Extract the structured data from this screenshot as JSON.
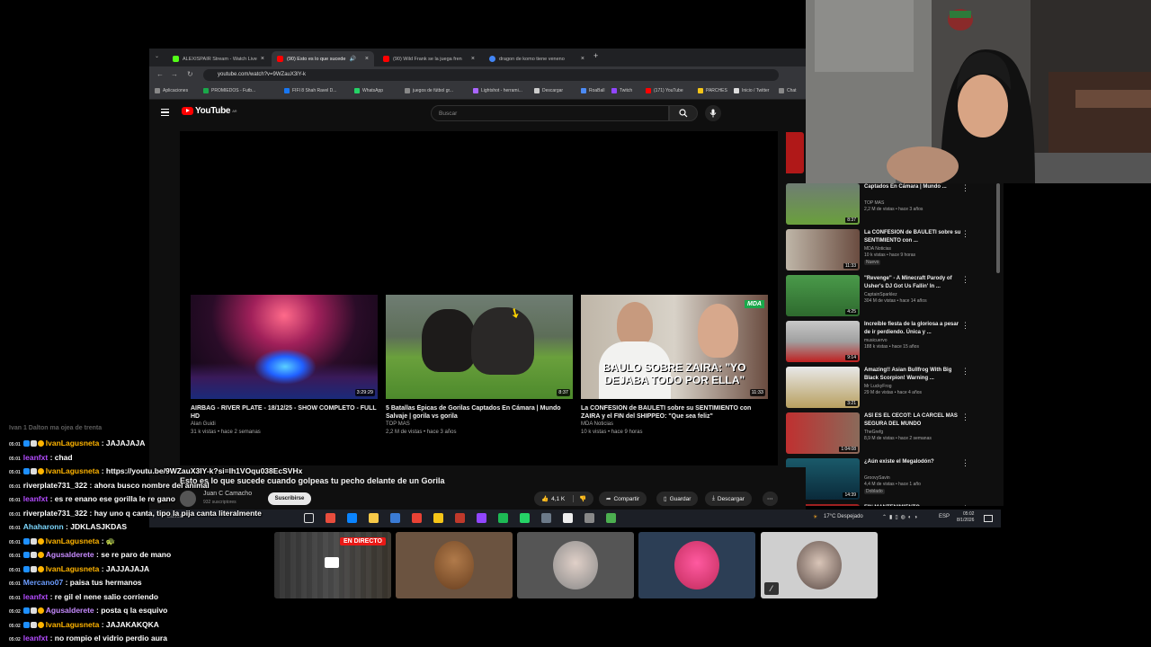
{
  "browser": {
    "tabs": [
      {
        "label": "ALEXISPAIR Stream - Watch Live",
        "fav": "#53fc18"
      },
      {
        "label": "(90) Esto es lo que sucede",
        "fav": "#ff0000"
      },
      {
        "label": "(90) Wild Frank se la juega fren",
        "fav": "#ff0000"
      },
      {
        "label": "dragon de komo tiene veneno",
        "fav": "#4285f4"
      }
    ],
    "url": "youtube.com/watch?v=9WZauX3lY-k",
    "bookmarks": [
      {
        "label": "Aplicaciones",
        "color": "#888"
      },
      {
        "label": "PROMIEDOS - Futb...",
        "color": "#1aa84a"
      },
      {
        "label": "FIFI 8 Shah Ravel D...",
        "color": "#1877f2"
      },
      {
        "label": "WhatsApp",
        "color": "#25d366"
      },
      {
        "label": "juegos de fútbol gr...",
        "color": "#888"
      },
      {
        "label": "Lightshot - herrami...",
        "color": "#aa66ff"
      },
      {
        "label": "Descargar",
        "color": "#ccc"
      },
      {
        "label": "RoaBall",
        "color": "#4c8bf5"
      },
      {
        "label": "Twitch",
        "color": "#9146ff"
      },
      {
        "label": "(171) YouTube",
        "color": "#ff0000"
      },
      {
        "label": "PARCHES",
        "color": "#f5c518"
      },
      {
        "label": "Inicio / Twitter",
        "color": "#ddd"
      },
      {
        "label": "Chat",
        "color": "#888"
      }
    ]
  },
  "youtube": {
    "logo": "YouTube",
    "logo_country": "AR",
    "search_placeholder": "Buscar",
    "endcards": [
      {
        "title": "AIRBAG - RIVER PLATE - 18/12/25 - SHOW COMPLETO - FULL HD",
        "channel": "Alan Guidi",
        "meta": "31 k vistas • hace 2 semanas",
        "duration": "3:29:29"
      },
      {
        "title": "5 Batallas Épicas de Gorilas Captados En Cámara | Mundo Salvaje | gorila vs gorila",
        "channel": "TOP MAS",
        "meta": "2,2 M de vistas • hace 3 años",
        "duration": "8:37"
      },
      {
        "title": "La CONFESIÓN de BAULETI sobre su SENTIMIENTO con ZAIRA y el FIN del SHIPPEO: \"Que sea feliz\"",
        "channel": "MDA Noticias",
        "meta": "10 k vistas • hace 9 horas",
        "duration": "11:33",
        "overlay": "BAULO SOBRE ZAIRA: \"YO DEJABA TODO POR ELLA\"",
        "badge": "MDA"
      }
    ],
    "video_title": "Esto es lo que sucede cuando golpeas tu pecho delante de un Gorila",
    "channel_name": "Juan C Camacho",
    "channel_subs": "932 suscriptores",
    "subscribe_label": "Suscribirse",
    "likes": "4,1 K",
    "share_label": "Compartir",
    "save_label": "Guardar",
    "download_label": "Descargar",
    "sidebar": [
      {
        "title": "Captados En Cámara | Mundo ...",
        "channel": "TOP MAS",
        "meta": "2,2 M de vistas • hace 3 años",
        "duration": "8:37"
      },
      {
        "title": "La CONFESIÓN de BAULETI sobre su SENTIMIENTO con ...",
        "channel": "MDA Noticias",
        "meta": "10 k vistas • hace 9 horas",
        "badge": "Nuevo",
        "duration": "11:33"
      },
      {
        "title": "\"Revenge\" - A Minecraft Parody of Usher's DJ Got Us Fallin' In ...",
        "channel": "CaptainSparklez",
        "meta": "304 M de vistas • hace 14 años",
        "duration": "4:25"
      },
      {
        "title": "Increíble fiesta de la gloriosa a pesar de ir perdiendo. Única y ...",
        "channel": "musicuervo",
        "meta": "188 k vistas • hace 15 años",
        "duration": "9:14"
      },
      {
        "title": "Amazing!! Asian Bullfrog With Big Black Scorpion! Warning ...",
        "channel": "Mr LuckyFrog",
        "meta": "29 M de vistas • hace 4 años",
        "duration": "3:21"
      },
      {
        "title": "ASÍ ES EL CECOT: LA CÁRCEL MÁS SEGURA DEL MUNDO",
        "channel": "TheGrefg",
        "meta": "8,9 M de vistas • hace 2 semanas",
        "duration": "1:04:08"
      },
      {
        "title": "¿Aún existe el Megalodón?",
        "channel": "GroovySavin",
        "meta": "4,4 M de vistas • hace 1 año",
        "badge": "Doblado",
        "duration": "14:39"
      },
      {
        "title": "FIN MANTENIMIENTO",
        "channel": "",
        "meta": "",
        "duration": ""
      }
    ]
  },
  "taskbar": {
    "search": "Buscar",
    "weather": "17°C  Despejado",
    "lang": "ESP",
    "time": "05:02",
    "date": "8/1/2026"
  },
  "chat": {
    "partial_top": "Ivan 1 Dalton ma ojea de trenta",
    "messages": [
      {
        "time": "05:01",
        "user": "IvanLagusneta",
        "color": "#ffb400",
        "text": "JAJAJAJA",
        "badges": 3
      },
      {
        "time": "05:01",
        "user": "leanfxt",
        "color": "#b44cff",
        "text": "chad",
        "badges": 0
      },
      {
        "time": "05:01",
        "user": "IvanLagusneta",
        "color": "#ffb400",
        "text": "https://youtu.be/9WZauX3IY-k?si=Ih1VOqu038EcSVHx",
        "badges": 3
      },
      {
        "time": "05:01",
        "user": "riverplate731_322",
        "color": "#ffffff",
        "text": "ahora busco nombre del animal",
        "badges": 0
      },
      {
        "time": "05:01",
        "user": "leanfxt",
        "color": "#b44cff",
        "text": "es re enano ese gorilla le re gano",
        "badges": 0
      },
      {
        "time": "05:01",
        "user": "riverplate731_322",
        "color": "#ffffff",
        "text": "hay uno q canta, tipo la pija canta literalmente",
        "badges": 0
      },
      {
        "time": "05:01",
        "user": "Ahaharonn",
        "color": "#7dd8ff",
        "text": "JDKLASJKDAS",
        "badges": 0
      },
      {
        "time": "05:01",
        "user": "IvanLagusneta",
        "color": "#ffb400",
        "text": "🐢",
        "badges": 3
      },
      {
        "time": "05:01",
        "user": "Agusalderete",
        "color": "#c78bff",
        "text": "se re paro de mano",
        "badges": 3
      },
      {
        "time": "05:01",
        "user": "IvanLagusneta",
        "color": "#ffb400",
        "text": "JAJJAJAJA",
        "badges": 3
      },
      {
        "time": "05:01",
        "user": "Mercano07",
        "color": "#6b9cff",
        "text": "paisa tus hermanos",
        "badges": 0
      },
      {
        "time": "05:01",
        "user": "leanfxt",
        "color": "#b44cff",
        "text": "re gil el nene salio corriendo",
        "badges": 0
      },
      {
        "time": "05:02",
        "user": "Agusalderete",
        "color": "#c78bff",
        "text": "posta q la esquivo",
        "badges": 3
      },
      {
        "time": "05:02",
        "user": "IvanLagusneta",
        "color": "#ffb400",
        "text": "JAJAKAKQKA",
        "badges": 3
      },
      {
        "time": "05:02",
        "user": "leanfxt",
        "color": "#b44cff",
        "text": "no rompio el vidrio perdio aura",
        "badges": 0
      }
    ]
  },
  "tiles": {
    "live_label": "EN DIRECTO"
  }
}
